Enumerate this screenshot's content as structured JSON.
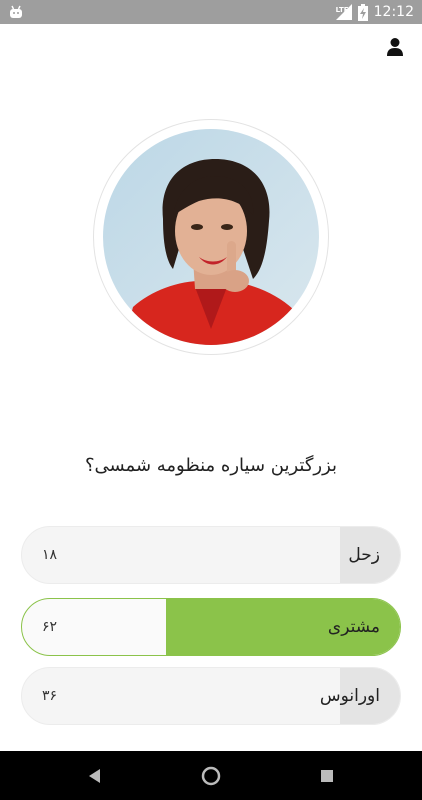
{
  "status_bar": {
    "time": "12:12",
    "network_label": "LTE",
    "icons": [
      "android-debug-icon",
      "signal-icon",
      "battery-charging-icon"
    ]
  },
  "toolbar": {
    "profile_icon": "person-icon"
  },
  "question": {
    "text": "بزرگترین سیاره منظومه شمسی؟"
  },
  "answers": [
    {
      "label": "زحل",
      "count": "۱۸",
      "percent": 18,
      "correct": false
    },
    {
      "label": "مشتری",
      "count": "۶۲",
      "percent": 62,
      "correct": true
    },
    {
      "label": "اورانوس",
      "count": "۳۶",
      "percent": 36,
      "correct": false
    }
  ],
  "nav": {
    "back_icon": "back-triangle-icon",
    "home_icon": "home-circle-icon",
    "recents_icon": "recents-square-icon"
  },
  "colors": {
    "correct": "#8bc34a",
    "answer_fill": "#e4e4e4",
    "answer_bg": "#f5f5f5",
    "status_bar": "#9e9e9e"
  }
}
